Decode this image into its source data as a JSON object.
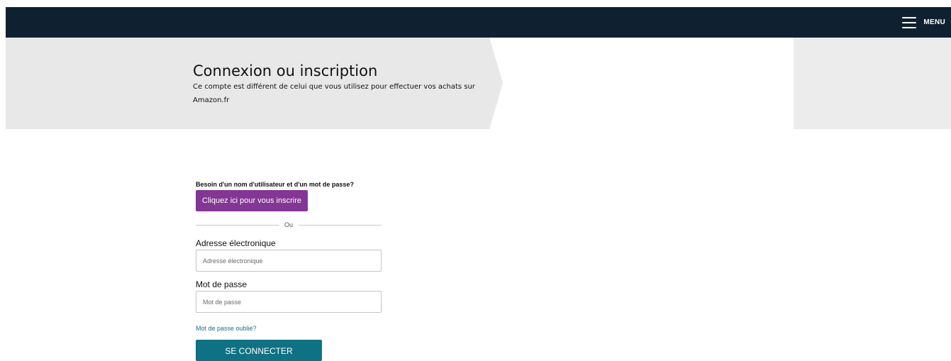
{
  "header": {
    "menu_label": "MENU",
    "menu_icon": "hamburger-icon",
    "background_color": "#0f2130"
  },
  "hero": {
    "title": "Connexion ou inscription",
    "subtitle": "Ce compte est différent de celui que vous utilisez pour effectuer vos achats sur Amazon.fr"
  },
  "form": {
    "need_credentials_text": "Besoin d'un nom d'utilisateur et d'un mot de passe?",
    "signup_button_label": "Cliquez ici pour vous inscrire",
    "divider_text": "Ou",
    "email_label": "Adresse électronique",
    "email_placeholder": "Adresse électronique",
    "email_value": "",
    "password_label": "Mot de passe",
    "password_placeholder": "Mot de passe",
    "password_value": "",
    "forgot_password_link": "Mot de passe oublié?",
    "login_button_label": "SE CONNECTER"
  },
  "colors": {
    "signup_button": "#833693",
    "login_button": "#0f7284",
    "link": "#1f6b8c",
    "hero_background": "#ececec"
  }
}
